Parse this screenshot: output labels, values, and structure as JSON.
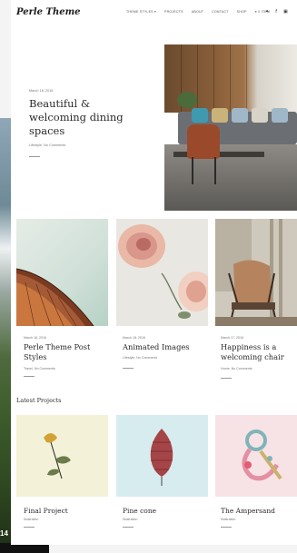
{
  "site": {
    "logo": "Perle Theme"
  },
  "nav": {
    "items": [
      "Theme styles ▾",
      "Projects",
      "About",
      "Contact",
      "Shop",
      "● 0 item"
    ],
    "social_icons": [
      "twitter-icon",
      "facebook-icon",
      "instagram-icon"
    ],
    "social_glyphs": [
      "✦",
      "f",
      "▣"
    ]
  },
  "hero": {
    "date": "March 18, 2016",
    "title": "Beautiful & welcoming dining spaces",
    "meta": "Lifestyle, No Comments"
  },
  "posts": [
    {
      "date": "March 18, 2016",
      "title": "Perle Theme Post Styles",
      "meta": "Travel, No Comments"
    },
    {
      "date": "March 18, 2016",
      "title": "Animated Images",
      "meta": "Lifestyle, No Comments"
    },
    {
      "date": "March 17, 2016",
      "title": "Happiness is a welcoming chair",
      "meta": "Home, No Comments"
    }
  ],
  "projects_section": {
    "title": "Latest Projects"
  },
  "projects": [
    {
      "title": "Final Project",
      "meta": "Illustration"
    },
    {
      "title": "Pine cone",
      "meta": "Illustration"
    },
    {
      "title": "The Ampersand",
      "meta": "Illustration"
    }
  ],
  "background": {
    "number": "14"
  }
}
